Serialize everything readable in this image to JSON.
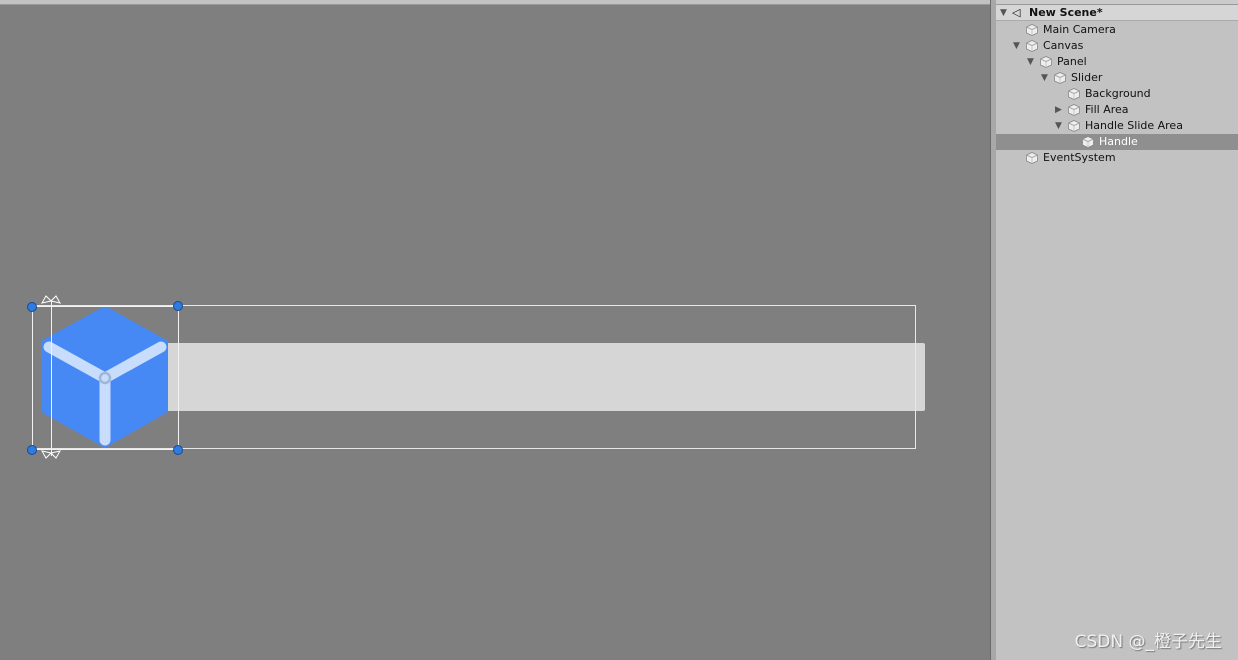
{
  "hierarchy": {
    "scene_name": "New Scene*",
    "items": [
      {
        "label": "Main Camera"
      },
      {
        "label": "Canvas"
      },
      {
        "label": "Panel"
      },
      {
        "label": "Slider"
      },
      {
        "label": "Background"
      },
      {
        "label": "Fill Area"
      },
      {
        "label": "Handle Slide Area"
      },
      {
        "label": "Handle"
      },
      {
        "label": "EventSystem"
      }
    ]
  },
  "scene": {
    "handle_color": "#4689f5",
    "slider_bg_color": "#d6d6d6",
    "slider_value": 0
  },
  "watermark": "CSDN @_橙子先生"
}
